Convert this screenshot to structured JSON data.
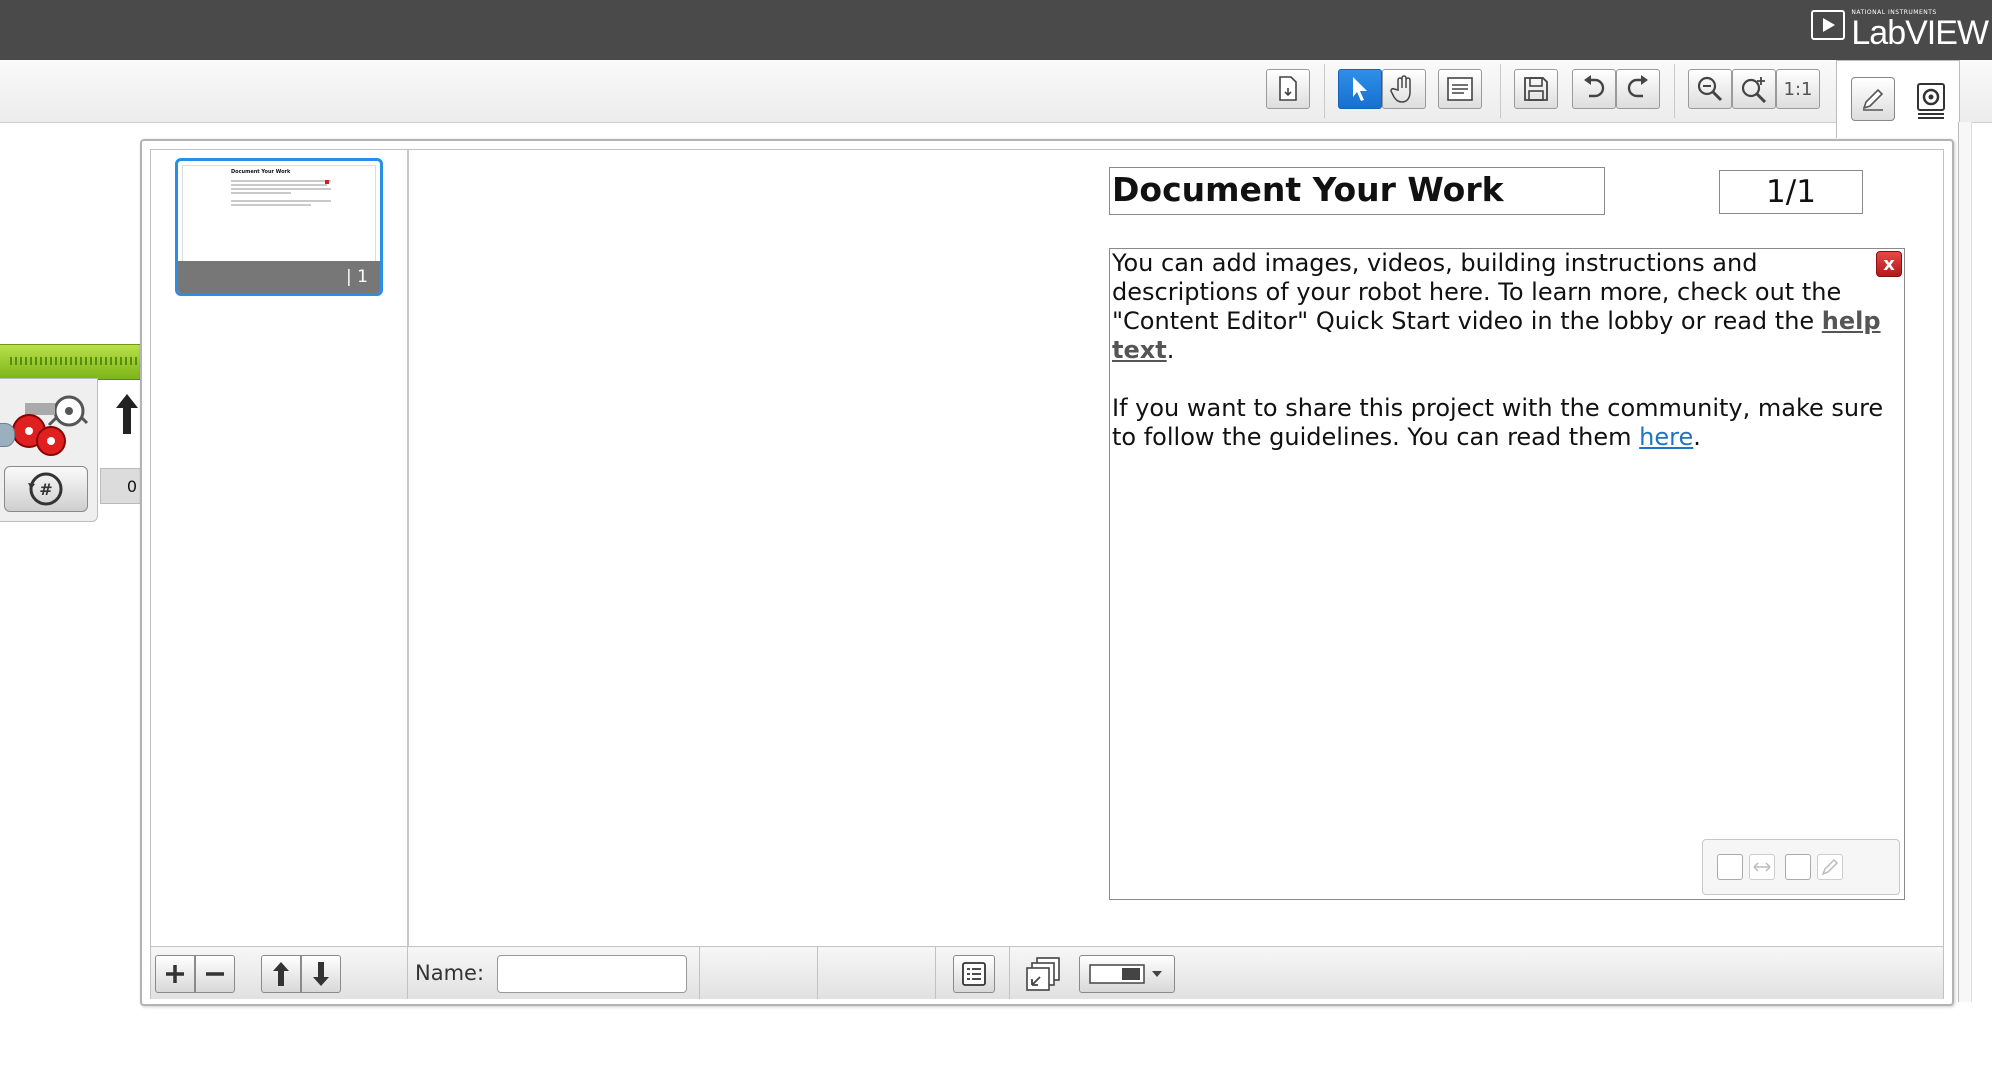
{
  "brand": {
    "small": "NATIONAL INSTRUMENTS",
    "name": "LabVIEW"
  },
  "toolbar": {
    "buttons": [
      "new-page-icon",
      "pointer-icon",
      "hand-icon",
      "comment-icon",
      "save-icon",
      "undo-icon",
      "redo-icon",
      "zoom-out-icon",
      "zoom-in-icon",
      "zoom-reset-icon"
    ],
    "zoom_reset_label": "1:1",
    "active_tool": "pointer-icon"
  },
  "program": {
    "port_value": "0"
  },
  "page_list": {
    "thumb_title": "Document Your Work",
    "thumb_number": "| 1"
  },
  "editor": {
    "title": "Document Your Work",
    "page_indicator": "1/1",
    "p1_text": "You can add images, videos, building instructions and descriptions of your robot here. To learn more, check out the \"Content Editor\" Quick Start video in the lobby or read the ",
    "p1_link": "help text",
    "p1_end": ".",
    "p2_text": "If you want to share this project with the community, make sure to follow the guidelines. You can read them ",
    "p2_link": "here",
    "p2_end": ".",
    "close_label": "x"
  },
  "bottom": {
    "name_label": "Name:",
    "name_value": ""
  },
  "colors": {
    "accent": "#1670cf",
    "topbar": "#4a4a4a",
    "green": "#7bb518",
    "close": "#c42020"
  }
}
